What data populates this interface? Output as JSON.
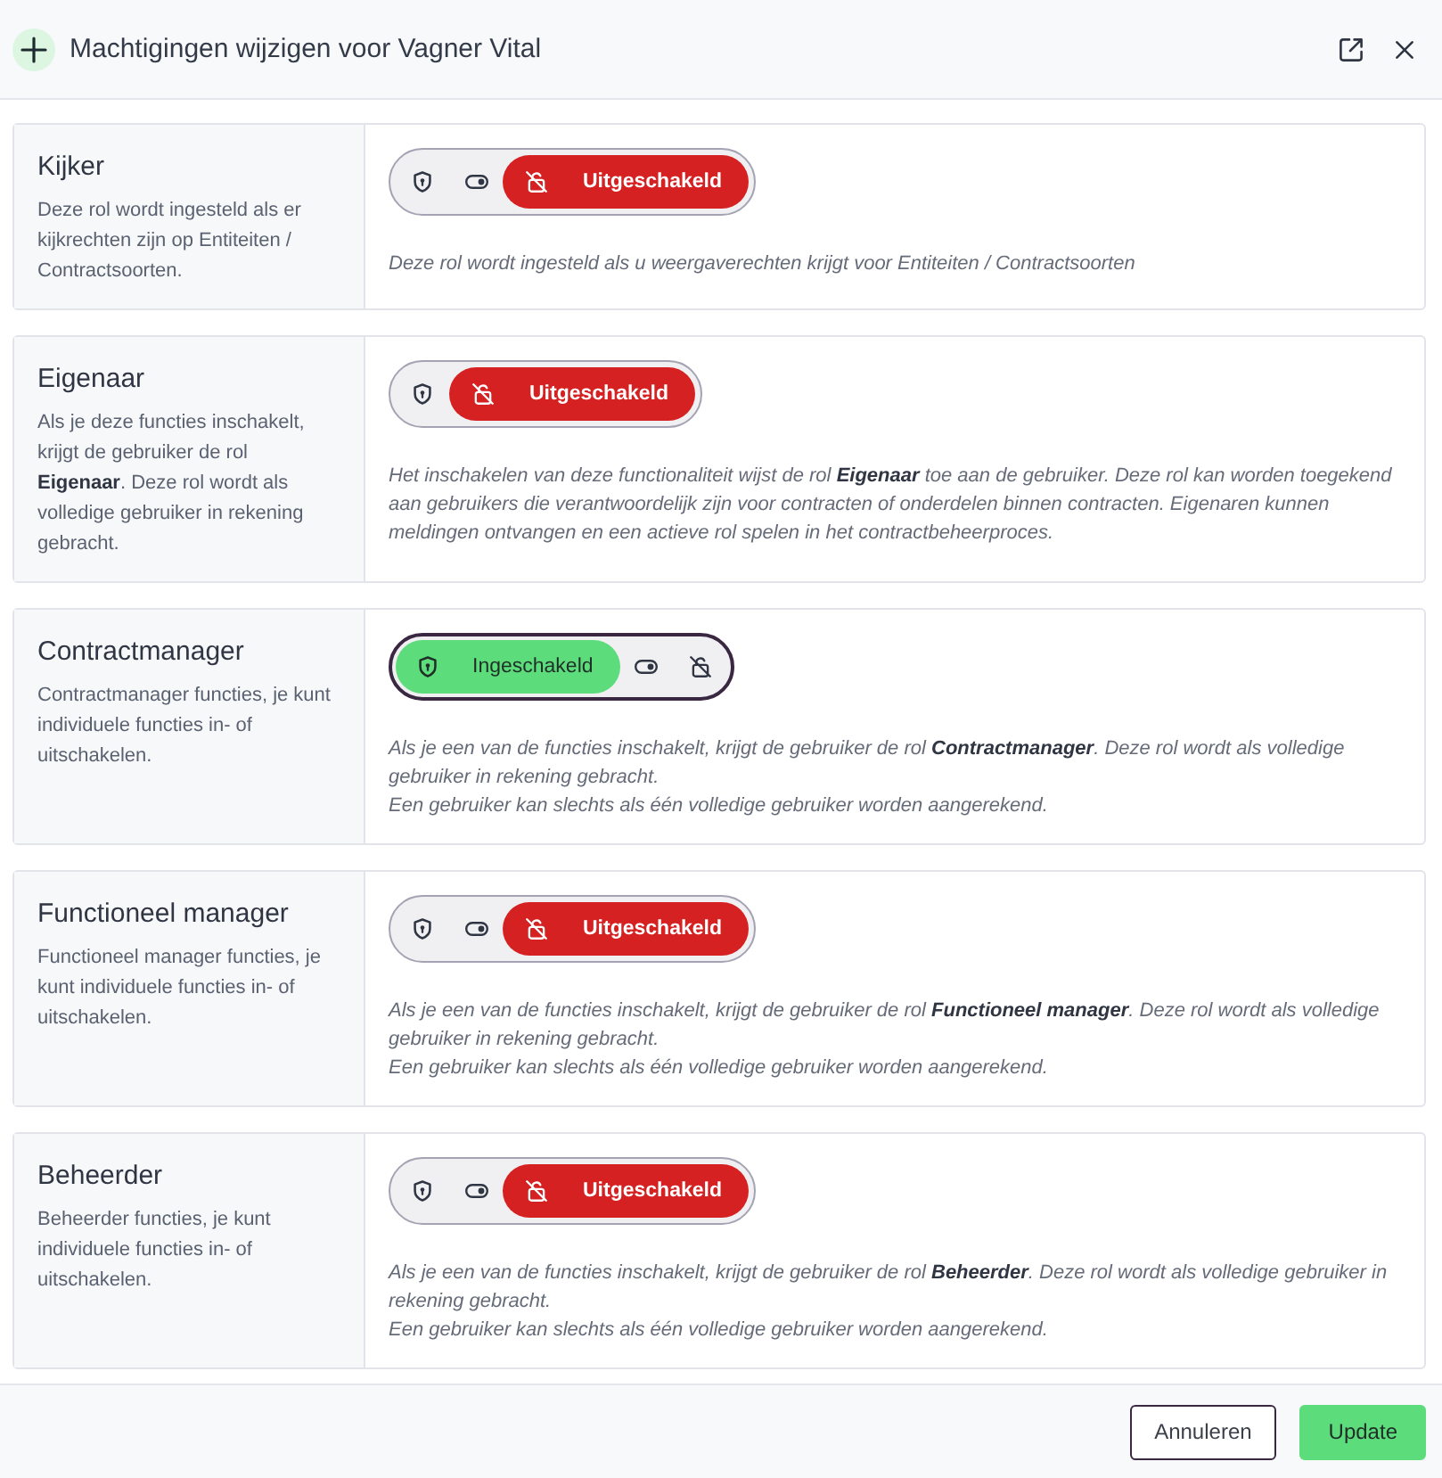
{
  "dialog": {
    "title": "Machtigingen wijzigen voor Vagner Vital"
  },
  "roles": [
    {
      "name": "Kijker",
      "description": "Deze rol wordt ingesteld als er kijkrechten zijn op Entiteiten / Contractsoorten.",
      "focused": false,
      "options": [
        {
          "kind": "enabled",
          "selected": false
        },
        {
          "kind": "custom",
          "selected": false
        },
        {
          "kind": "disabled",
          "selected": true,
          "label": "Uitgeschakeld"
        }
      ],
      "note": [
        "Deze rol wordt ingesteld als u weergaverechten krijgt voor Entiteiten / Contractsoorten"
      ]
    },
    {
      "name": "Eigenaar",
      "description": "Als je deze functies inschakelt, krijgt de gebruiker de rol **Eigenaar**. Deze rol wordt als volledige gebruiker in rekening gebracht.",
      "focused": false,
      "options": [
        {
          "kind": "enabled",
          "selected": false
        },
        {
          "kind": "disabled",
          "selected": true,
          "label": "Uitgeschakeld"
        }
      ],
      "note": [
        "Het inschakelen van deze functionaliteit wijst de rol **Eigenaar** toe aan de gebruiker. Deze rol kan worden toegekend aan gebruikers die verantwoordelijk zijn voor contracten of onderdelen binnen contracten. Eigenaren kunnen meldingen ontvangen en een actieve rol spelen in het contractbeheerproces."
      ]
    },
    {
      "name": "Contractmanager",
      "description": "Contractmanager functies, je kunt individuele functies in- of uitschakelen.",
      "focused": true,
      "options": [
        {
          "kind": "enabled",
          "selected": true,
          "label": "Ingeschakeld"
        },
        {
          "kind": "custom",
          "selected": false
        },
        {
          "kind": "disabled",
          "selected": false
        }
      ],
      "note": [
        "Als je een van de functies inschakelt, krijgt de gebruiker de rol **Contractmanager**. Deze rol wordt als volledige gebruiker in rekening gebracht.",
        "Een gebruiker kan slechts als één volledige gebruiker worden aangerekend."
      ]
    },
    {
      "name": "Functioneel manager",
      "description": "Functioneel manager functies, je kunt individuele functies in- of uitschakelen.",
      "focused": false,
      "options": [
        {
          "kind": "enabled",
          "selected": false
        },
        {
          "kind": "custom",
          "selected": false
        },
        {
          "kind": "disabled",
          "selected": true,
          "label": "Uitgeschakeld"
        }
      ],
      "note": [
        "Als je een van de functies inschakelt, krijgt de gebruiker de rol **Functioneel manager**. Deze rol wordt als volledige gebruiker in rekening gebracht.",
        "Een gebruiker kan slechts als één volledige gebruiker worden aangerekend."
      ]
    },
    {
      "name": "Beheerder",
      "description": "Beheerder functies, je kunt individuele functies in- of uitschakelen.",
      "focused": false,
      "options": [
        {
          "kind": "enabled",
          "selected": false
        },
        {
          "kind": "custom",
          "selected": false
        },
        {
          "kind": "disabled",
          "selected": true,
          "label": "Uitgeschakeld"
        }
      ],
      "note": [
        "Als je een van de functies inschakelt, krijgt de gebruiker de rol **Beheerder**. Deze rol wordt als volledige gebruiker in rekening gebracht.",
        "Een gebruiker kan slechts als één volledige gebruiker worden aangerekend."
      ]
    }
  ],
  "buttons": [
    {
      "kind": "secondary",
      "label": "Annuleren"
    },
    {
      "kind": "primary",
      "label": "Update"
    }
  ]
}
